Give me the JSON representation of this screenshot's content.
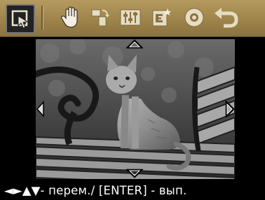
{
  "toolbar": {
    "tools": [
      {
        "id": "select",
        "icon": "select-cursor-icon",
        "selected": true
      },
      {
        "id": "hand",
        "icon": "hand-icon",
        "selected": false
      },
      {
        "id": "rotate",
        "icon": "rotate-icon",
        "selected": false
      },
      {
        "id": "adjust",
        "icon": "adjust-sliders-icon",
        "selected": false
      },
      {
        "id": "edit",
        "icon": "edit-frame-icon",
        "selected": false
      },
      {
        "id": "red-eye",
        "icon": "eye-icon",
        "selected": false
      },
      {
        "id": "undo",
        "icon": "undo-icon",
        "selected": false
      }
    ]
  },
  "preview": {
    "arrows": [
      "arrow-up-icon",
      "arrow-down-icon",
      "arrow-left-icon",
      "arrow-right-icon"
    ]
  },
  "footer": {
    "hint": "◄►▲▼- перем./ [ENTER] - вып."
  },
  "colors": {
    "toolbar": "#a68c52",
    "icon": "#f4efe2",
    "background": "#000000",
    "text": "#ffffff"
  }
}
